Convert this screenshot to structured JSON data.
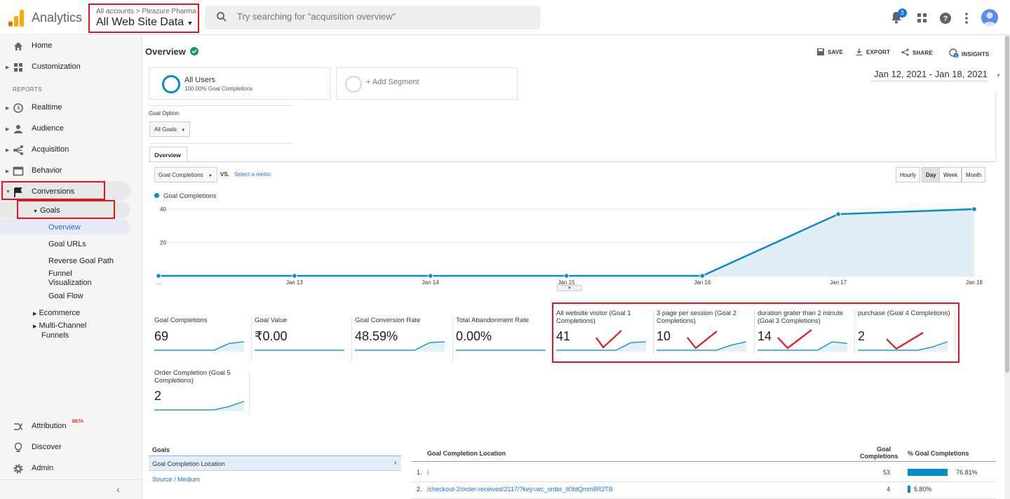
{
  "app": {
    "title": "Analytics"
  },
  "account": {
    "crumb": "All accounts > Pleazure Pharma",
    "view": "All Web Site Data"
  },
  "search": {
    "placeholder": "Try searching for \"acquisition overview\""
  },
  "notifications": {
    "count": "3"
  },
  "sidebar": {
    "home": "Home",
    "customization": "Customization",
    "reports_header": "REPORTS",
    "realtime": "Realtime",
    "audience": "Audience",
    "acquisition": "Acquisition",
    "behavior": "Behavior",
    "conversions": "Conversions",
    "goals": "Goals",
    "goal_items": [
      "Overview",
      "Goal URLs",
      "Reverse Goal Path",
      "Funnel",
      "Visualization",
      "Goal Flow"
    ],
    "ecommerce": "Ecommerce",
    "multichannel_1": "Multi-Channel",
    "multichannel_2": "Funnels",
    "attribution": "Attribution",
    "attribution_badge": "BETA",
    "discover": "Discover",
    "admin": "Admin"
  },
  "page": {
    "title": "Overview",
    "toolbar": {
      "save": "SAVE",
      "export": "EXPORT",
      "share": "SHARE",
      "insights": "INSIGHTS"
    },
    "segment_all": {
      "name": "All Users",
      "sub": "100.00% Goal Completions"
    },
    "segment_add": "+ Add Segment",
    "date_range": "Jan 12, 2021 - Jan 18, 2021",
    "goal_option_label": "Goal Option:",
    "goal_option_value": "All Goals",
    "tab_overview": "Overview",
    "metric_select": "Goal Completions",
    "vs": "VS.",
    "select_metric": "Select a metric",
    "granularity": [
      "Hourly",
      "Day",
      "Week",
      "Month"
    ],
    "granularity_active": "Day"
  },
  "chart_data": {
    "type": "area",
    "legend": "Goal Completions",
    "x": [
      "...",
      "Jan 13",
      "Jan 14",
      "Jan 15",
      "Jan 16",
      "Jan 17",
      "Jan 18"
    ],
    "y": [
      0,
      0,
      0,
      0,
      0,
      37,
      40
    ],
    "yticks": [
      "40",
      "20"
    ],
    "ylim": [
      0,
      40
    ],
    "color": "#058dc7"
  },
  "metrics": [
    {
      "title": "Goal Completions",
      "value": "69"
    },
    {
      "title": "Goal Value",
      "value": "₹0.00"
    },
    {
      "title": "Goal Conversion Rate",
      "value": "48.59%"
    },
    {
      "title": "Total Abandonment Rate",
      "value": "0.00%"
    },
    {
      "title": "All website visitor (Goal 1 Completions)",
      "value": "41"
    },
    {
      "title": "3 page per session (Goal 2 Completions)",
      "value": "10"
    },
    {
      "title": "duration grater than 2 minute (Goal 3 Completions)",
      "value": "14"
    },
    {
      "title": "purchase (Goal 4 Completions)",
      "value": "2"
    },
    {
      "title": "Order Completion (Goal 5 Completions)",
      "value": "2"
    }
  ],
  "table": {
    "left_header": "Goals",
    "left_items": [
      "Goal Completion Location",
      "Source / Medium"
    ],
    "col1": "Goal Completion Location",
    "col2a": "Goal",
    "col2b": "Completions",
    "col3": "% Goal Completions",
    "rows": [
      {
        "idx": "1.",
        "loc": "/",
        "count": "53",
        "pct": "76.81%",
        "fraction": 0.7681
      },
      {
        "idx": "2.",
        "loc": "/checkout-2/order-received/2117/?key=wc_order_lt0btQmm8R2TB",
        "count": "4",
        "pct": "5.80%",
        "fraction": 0.058
      }
    ]
  }
}
